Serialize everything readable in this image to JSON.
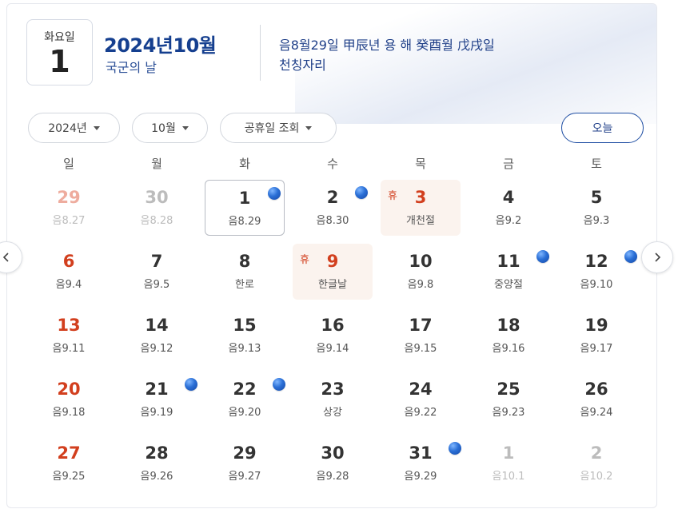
{
  "header": {
    "weekday": "화요일",
    "day": "1",
    "year_month": "2024년10월",
    "holiday_name": "국군의 날",
    "lunar_line1": "음8월29일 甲辰년 용 해 癸酉월 戊戌일",
    "lunar_line2": "천칭자리"
  },
  "controls": {
    "year_select": "2024년",
    "month_select": "10월",
    "holiday_query": "공휴일 조회",
    "today_button": "오늘"
  },
  "weekdays": [
    "일",
    "월",
    "화",
    "수",
    "목",
    "금",
    "토"
  ],
  "holiday_badge": "휴",
  "nav_icons": {
    "prev": "chevron-left-icon",
    "next": "chevron-right-icon"
  },
  "colors": {
    "accent": "#1f3f88",
    "sunday": "#d23f1e",
    "holiday_bg": "#fbf3ee",
    "event_dot": "#2a6fd6"
  },
  "weeks": [
    [
      {
        "day": "29",
        "sub": "음8.27",
        "other": true
      },
      {
        "day": "30",
        "sub": "음8.28",
        "other": true
      },
      {
        "day": "1",
        "sub": "음8.29",
        "today": true,
        "dot": true
      },
      {
        "day": "2",
        "sub": "음8.30",
        "dot": true
      },
      {
        "day": "3",
        "sub": "개천절",
        "holiday": true
      },
      {
        "day": "4",
        "sub": "음9.2"
      },
      {
        "day": "5",
        "sub": "음9.3"
      }
    ],
    [
      {
        "day": "6",
        "sub": "음9.4"
      },
      {
        "day": "7",
        "sub": "음9.5"
      },
      {
        "day": "8",
        "sub": "한로"
      },
      {
        "day": "9",
        "sub": "한글날",
        "holiday": true
      },
      {
        "day": "10",
        "sub": "음9.8"
      },
      {
        "day": "11",
        "sub": "중양절",
        "dot": true
      },
      {
        "day": "12",
        "sub": "음9.10",
        "dot": true
      }
    ],
    [
      {
        "day": "13",
        "sub": "음9.11"
      },
      {
        "day": "14",
        "sub": "음9.12"
      },
      {
        "day": "15",
        "sub": "음9.13"
      },
      {
        "day": "16",
        "sub": "음9.14"
      },
      {
        "day": "17",
        "sub": "음9.15"
      },
      {
        "day": "18",
        "sub": "음9.16"
      },
      {
        "day": "19",
        "sub": "음9.17"
      }
    ],
    [
      {
        "day": "20",
        "sub": "음9.18"
      },
      {
        "day": "21",
        "sub": "음9.19",
        "dot": true
      },
      {
        "day": "22",
        "sub": "음9.20",
        "dot": true
      },
      {
        "day": "23",
        "sub": "상강"
      },
      {
        "day": "24",
        "sub": "음9.22"
      },
      {
        "day": "25",
        "sub": "음9.23"
      },
      {
        "day": "26",
        "sub": "음9.24"
      }
    ],
    [
      {
        "day": "27",
        "sub": "음9.25"
      },
      {
        "day": "28",
        "sub": "음9.26"
      },
      {
        "day": "29",
        "sub": "음9.27"
      },
      {
        "day": "30",
        "sub": "음9.28"
      },
      {
        "day": "31",
        "sub": "음9.29",
        "dot": true
      },
      {
        "day": "1",
        "sub": "음10.1",
        "other": true
      },
      {
        "day": "2",
        "sub": "음10.2",
        "other": true
      }
    ]
  ]
}
